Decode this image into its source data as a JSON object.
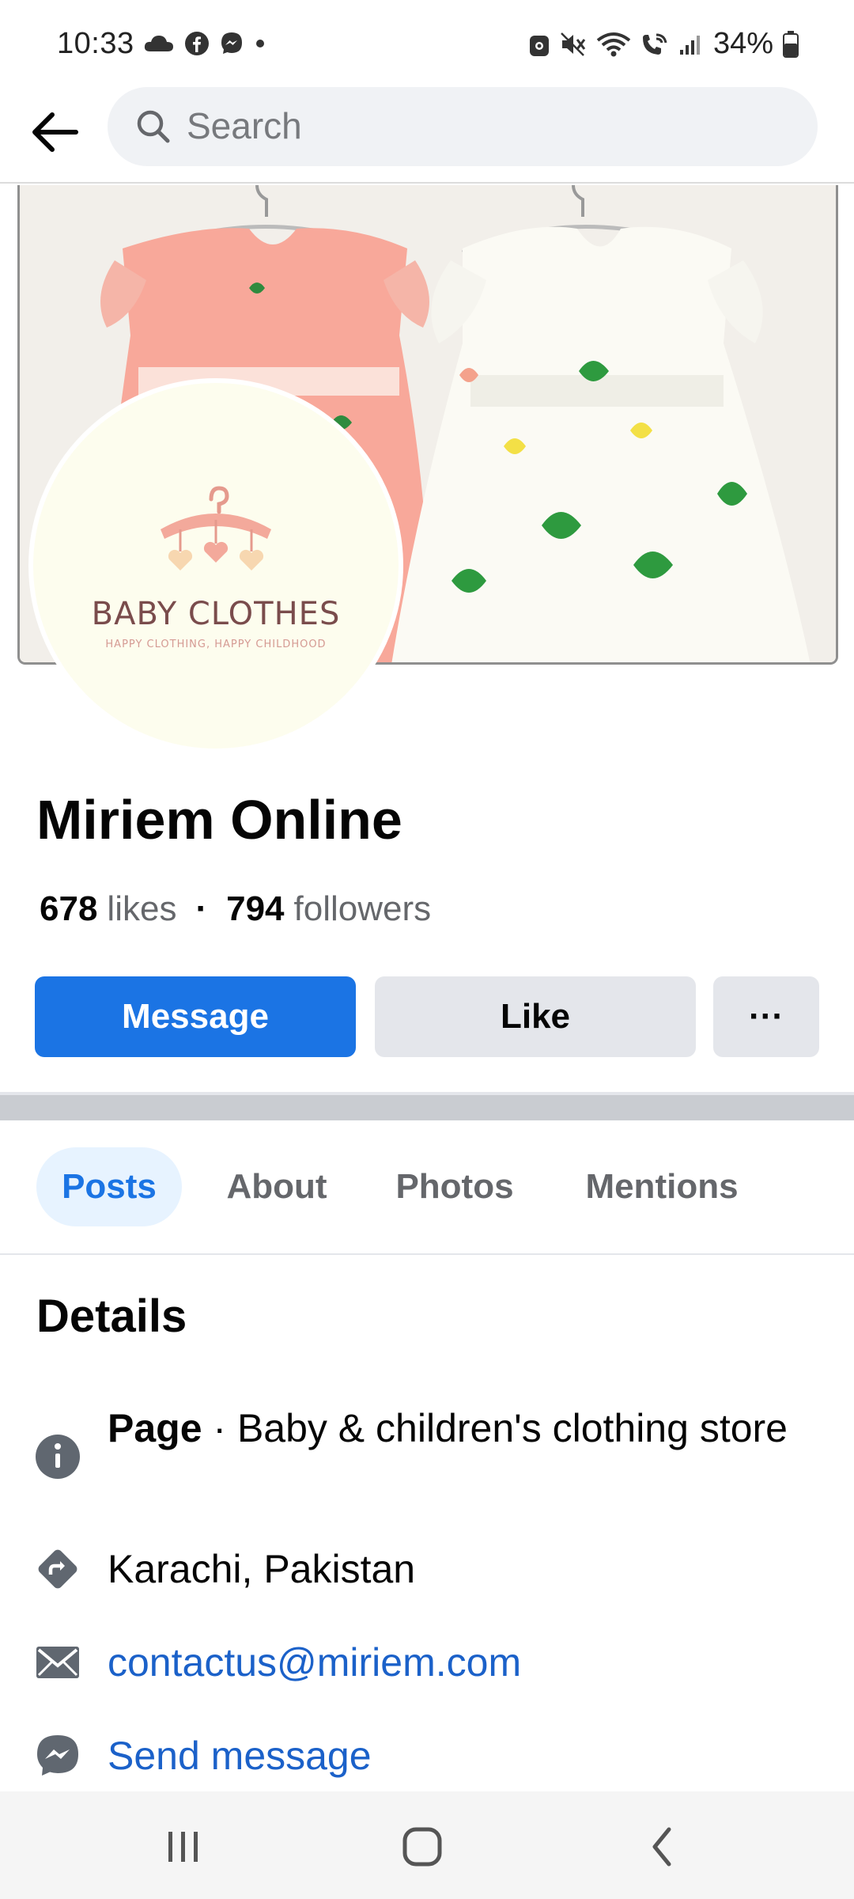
{
  "status_bar": {
    "time": "10:33",
    "left_icons": [
      "cloud-icon",
      "facebook-icon",
      "messenger-icon",
      "dot-icon"
    ],
    "right_icons": [
      "lock-icon",
      "mute-icon",
      "wifi-icon",
      "wifi-call-icon",
      "signal-icon",
      "battery-icon"
    ],
    "battery_percent": "34%"
  },
  "header": {
    "search_placeholder": "Search"
  },
  "cover": {
    "avatar_brand": "BABY CLOTHES",
    "avatar_tagline": "HAPPY CLOTHING, HAPPY CHILDHOOD"
  },
  "page": {
    "name": "Miriem Online",
    "likes_count": "678",
    "likes_label": "likes",
    "followers_count": "794",
    "followers_label": "followers"
  },
  "actions": {
    "message_label": "Message",
    "like_label": "Like",
    "more_label": "···"
  },
  "tabs": [
    {
      "label": "Posts",
      "active": true
    },
    {
      "label": "About",
      "active": false
    },
    {
      "label": "Photos",
      "active": false
    },
    {
      "label": "Mentions",
      "active": false
    }
  ],
  "details": {
    "title": "Details",
    "category_prefix": "Page",
    "category_separator": " · ",
    "category": "Baby & children's clothing store",
    "location": "Karachi, Pakistan",
    "email": "contactus@miriem.com",
    "send_message": "Send message"
  },
  "colors": {
    "accent": "#1b74e4",
    "link": "#1b61c9",
    "button_gray": "#e4e6eb",
    "tab_active_bg": "#e7f3ff"
  }
}
